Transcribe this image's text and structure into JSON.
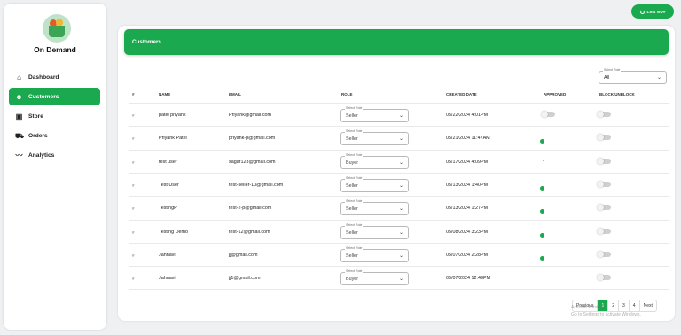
{
  "brand": {
    "name": "On Demand",
    "logo_icon": "grocery-basket-logo"
  },
  "sidebar": {
    "items": [
      {
        "label": "Dashboard",
        "icon": "home-icon",
        "active": false
      },
      {
        "label": "Customers",
        "icon": "customers-icon",
        "active": true
      },
      {
        "label": "Store",
        "icon": "store-icon",
        "active": false
      },
      {
        "label": "Orders",
        "icon": "cart-icon",
        "active": false
      },
      {
        "label": "Analytics",
        "icon": "chart-line-icon",
        "active": false
      }
    ]
  },
  "header": {
    "logout_label": "LOG OUT"
  },
  "page": {
    "title": "Customers"
  },
  "filter": {
    "label": "Select Role",
    "value": "All"
  },
  "table": {
    "headers": [
      "#",
      "NAME",
      "EMAIL",
      "ROLE",
      "CREATED DATE",
      "APPROVED",
      "BLOCK/UNBLOCK"
    ],
    "role_select_label": "Select Role",
    "rows": [
      {
        "hash": "#",
        "name": "patel priyank",
        "email": "Priyank@gmail.com",
        "role": "Seller",
        "created": "05/22/2024 4:01PM",
        "approved": "toggle"
      },
      {
        "hash": "#",
        "name": "Priyank Patel",
        "email": "priyank-p@gmail.com",
        "role": "Seller",
        "created": "05/21/2024 11:47AM",
        "approved": "dot"
      },
      {
        "hash": "#",
        "name": "test user",
        "email": "sagar123@gmail.com",
        "role": "Buyer",
        "created": "05/17/2024 4:09PM",
        "approved": "dash"
      },
      {
        "hash": "#",
        "name": "Test User",
        "email": "test-seller-10@gmail.com",
        "role": "Seller",
        "created": "05/13/2024 1:40PM",
        "approved": "dot"
      },
      {
        "hash": "#",
        "name": "TestingP",
        "email": "test-2-p@gmail.com",
        "role": "Seller",
        "created": "05/13/2024 1:27PM",
        "approved": "dot"
      },
      {
        "hash": "#",
        "name": "Testing Demo",
        "email": "test-12@gmail.com",
        "role": "Seller",
        "created": "05/08/2024 3:23PM",
        "approved": "dot"
      },
      {
        "hash": "#",
        "name": "Jahnavi",
        "email": "jj@gmail.com",
        "role": "Seller",
        "created": "05/07/2024 2:28PM",
        "approved": "dot"
      },
      {
        "hash": "#",
        "name": "Jahnavi",
        "email": "jj1@gmail.com",
        "role": "Buyer",
        "created": "05/07/2024 12:49PM",
        "approved": "dash"
      }
    ],
    "dash_text": "-"
  },
  "pagination": {
    "previous": "Previous",
    "pages": [
      "1",
      "2",
      "3",
      "4"
    ],
    "current": "1",
    "next": "Next"
  },
  "watermark": {
    "line1": "Activate Windows",
    "line2": "Go to Settings to activate Windows."
  },
  "colors": {
    "accent": "#1aa94f"
  }
}
